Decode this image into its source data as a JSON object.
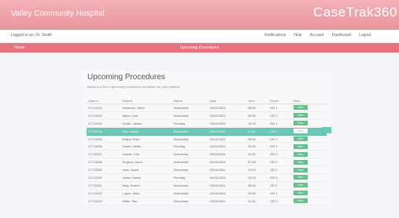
{
  "header": {
    "hospital_name": "Valley Community Hospital",
    "brand_name": "CaseTrak360"
  },
  "user_bar": {
    "login_status": "Logged in as: Dr. Smith",
    "links": [
      "Notifications",
      "Help",
      "Account",
      "Dashboard",
      "Logout"
    ]
  },
  "section_bar": {
    "home_label": "Home",
    "title": "Upcoming Procedures"
  },
  "main": {
    "title": "Upcoming Procedures",
    "subtitle": "Below is a list of upcoming procedures scheduled for your patients.",
    "table": {
      "columns": [
        "Case #",
        "Patient",
        "Status",
        "Date",
        "Time",
        "Room",
        "View"
      ],
      "rows": [
        [
          "CT-10231",
          "Anderson, Mark",
          "Scheduled",
          "03/12/2024",
          "08:00",
          "OR 1",
          "View"
        ],
        [
          "CT-10232",
          "Baker, Lisa",
          "Scheduled",
          "03/12/2024",
          "09:30",
          "OR 2",
          "View"
        ],
        [
          "CT-10233",
          "Carter, James",
          "Pending",
          "03/12/2024",
          "10:15",
          "OR 1",
          "View"
        ],
        [
          "CT-10234",
          "Diaz, Maria",
          "Scheduled",
          "03/12/2024",
          "11:00",
          "OR 3",
          "View"
        ],
        [
          "CT-10235",
          "Evans, Paul",
          "Scheduled",
          "03/13/2024",
          "08:30",
          "OR 2",
          "View"
        ],
        [
          "CT-10236",
          "Foster, Helen",
          "Pending",
          "03/13/2024",
          "09:45",
          "OR 1",
          "View"
        ],
        [
          "CT-10237",
          "Garcia, Luis",
          "Scheduled",
          "03/13/2024",
          "11:30",
          "OR 3",
          "View"
        ],
        [
          "CT-10238",
          "Hughes, Anna",
          "Scheduled",
          "03/14/2024",
          "07:45",
          "OR 2",
          "View"
        ],
        [
          "CT-10239",
          "Irwin, David",
          "Scheduled",
          "03/14/2024",
          "10:00",
          "OR 1",
          "View"
        ],
        [
          "CT-10240",
          "Jones, Karen",
          "Pending",
          "03/14/2024",
          "13:15",
          "OR 3",
          "View"
        ],
        [
          "CT-10241",
          "King, Robert",
          "Scheduled",
          "03/15/2024",
          "08:00",
          "OR 2",
          "View"
        ],
        [
          "CT-10242",
          "Lopez, Sara",
          "Scheduled",
          "03/15/2024",
          "09:30",
          "OR 1",
          "View"
        ],
        [
          "CT-10243",
          "Miller, Tom",
          "Scheduled",
          "03/15/2024",
          "11:00",
          "OR 3",
          "View"
        ]
      ],
      "highlighted_row": 3
    }
  },
  "colors": {
    "header": "#ee9ea6",
    "section_bar": "#e8737e",
    "highlight_row": "#6cc7b4",
    "view_button": "#67c08c"
  }
}
